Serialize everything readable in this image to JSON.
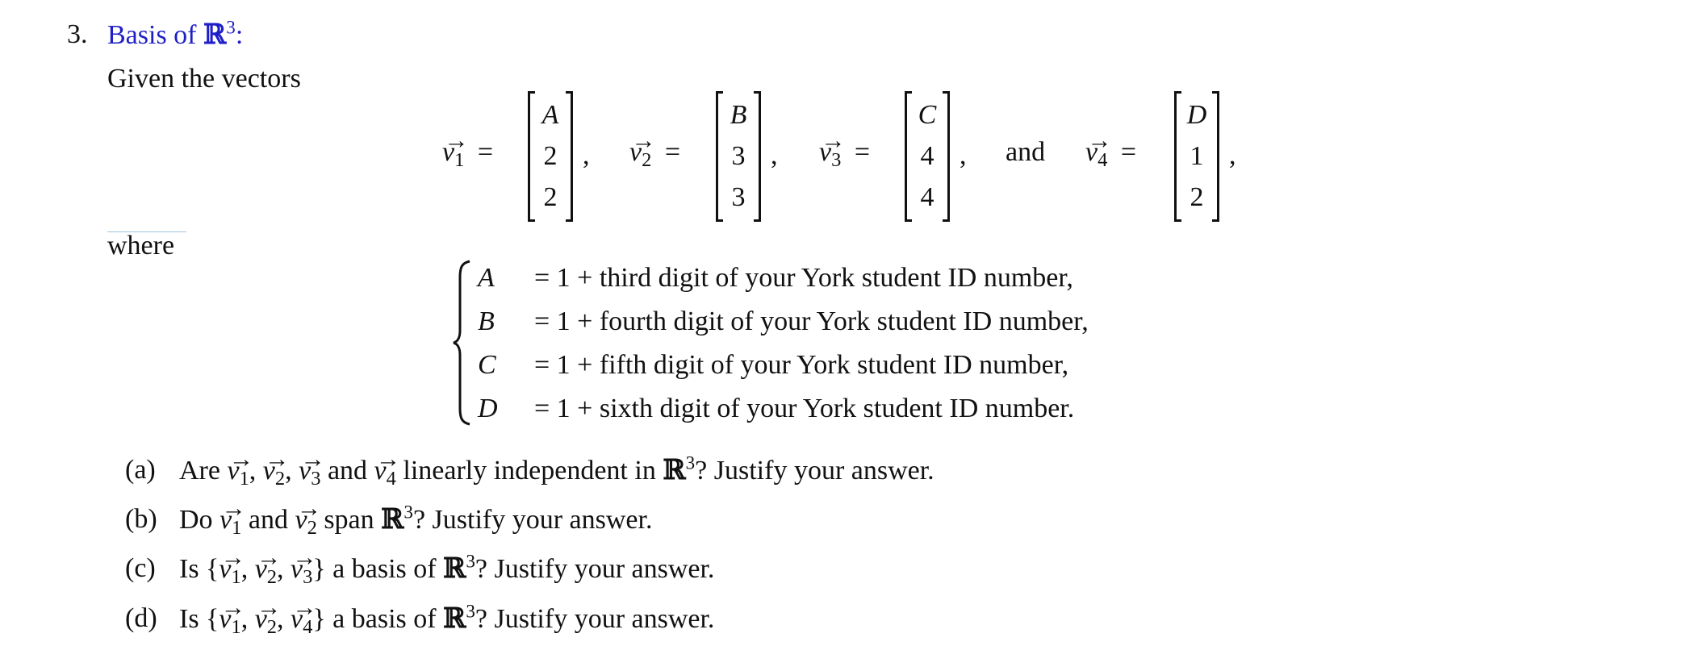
{
  "problem": {
    "number": "3.",
    "title": "Basis of ",
    "title_space": "ℝ",
    "title_exponent": "3",
    "title_suffix": ":",
    "title_color": "#1f1fc8"
  },
  "intro": "Given the vectors",
  "vectors": [
    {
      "symbol": "v",
      "index": "1",
      "entries": [
        "A",
        "2",
        "2"
      ],
      "trail": ","
    },
    {
      "symbol": "v",
      "index": "2",
      "entries": [
        "B",
        "3",
        "3"
      ],
      "trail": ","
    },
    {
      "symbol": "v",
      "index": "3",
      "entries": [
        "C",
        "4",
        "4"
      ],
      "trail": ","
    },
    {
      "symbol": "v",
      "index": "4",
      "entries": [
        "D",
        "1",
        "2"
      ],
      "trail": ","
    }
  ],
  "connector_and": "and",
  "equals": "=",
  "arrow": "→",
  "where_label": "where",
  "definitions": [
    {
      "var": "A",
      "rhs": "= 1 + third digit of your York student ID number,"
    },
    {
      "var": "B",
      "rhs": "= 1 + fourth digit of your York student ID number,"
    },
    {
      "var": "C",
      "rhs": "= 1 + fifth digit of your York student ID number,"
    },
    {
      "var": "D",
      "rhs": "= 1 + sixth digit of your York student ID number."
    }
  ],
  "questions": [
    {
      "label": "(a)",
      "parts": {
        "p1": "Are ",
        "s1": ", ",
        "s2": ", ",
        "s3": " and ",
        "p2": " linearly independent in ",
        "p3": "? Justify your answer."
      }
    },
    {
      "label": "(b)",
      "parts": {
        "p1": "Do ",
        "s1": " and ",
        "p2": " span ",
        "p3": "? Justify your answer."
      }
    },
    {
      "label": "(c)",
      "parts": {
        "p1": "Is {",
        "s1": ", ",
        "s2": ", ",
        "p2": "} a basis of ",
        "p3": "? Justify your answer."
      }
    },
    {
      "label": "(d)",
      "parts": {
        "p1": "Is {",
        "s1": ", ",
        "s2": ", ",
        "p2": "} a basis of ",
        "p3": "? Justify your answer."
      }
    }
  ]
}
